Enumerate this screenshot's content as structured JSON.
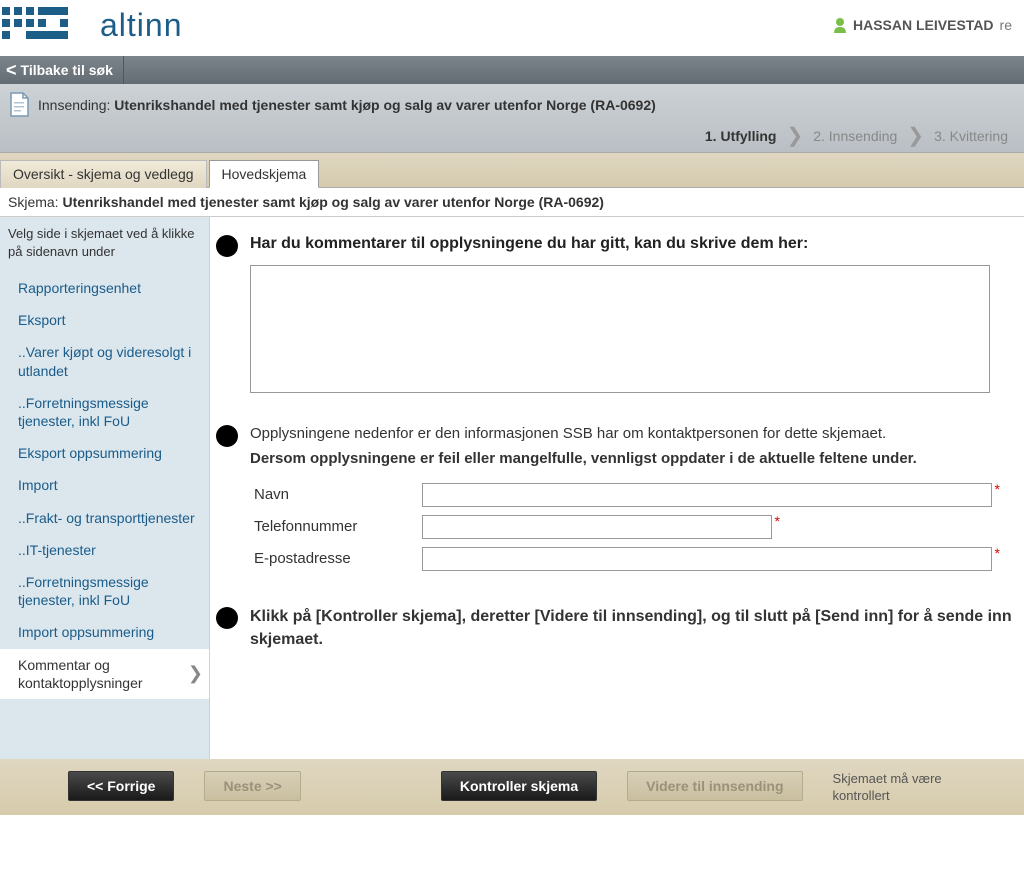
{
  "header": {
    "brand": "altinn",
    "user_name": "HASSAN LEIVESTAD",
    "user_suffix": "re"
  },
  "back": {
    "label": "Tilbake til søk",
    "caret": "<"
  },
  "submission": {
    "prefix": "Innsending: ",
    "title": "Utenrikshandel med tjenester samt kjøp og salg av varer utenfor Norge (RA-0692)"
  },
  "steps": {
    "s1": "1. Utfylling",
    "s2": "2. Innsending",
    "s3": "3. Kvittering",
    "sep": "❯"
  },
  "tabs": {
    "overview": "Oversikt - skjema og vedlegg",
    "main": "Hovedskjema"
  },
  "schema": {
    "prefix": "Skjema: ",
    "title": "Utenrikshandel med tjenester samt kjøp og salg av varer utenfor Norge (RA-0692)"
  },
  "sidebar": {
    "instructions": "Velg side i skjemaet ved å klikke på sidenavn under",
    "items": [
      "Rapporteringsenhet",
      "Eksport",
      "..Varer kjøpt og videresolgt i utlandet",
      "..Forretningsmessige tjenester, inkl FoU",
      "Eksport oppsummering",
      "Import",
      "..Frakt- og transporttjenester",
      "..IT-tjenester",
      "..Forretningsmessige tjenester, inkl FoU",
      "Import oppsummering",
      "Kommentar og kontaktopplysninger"
    ]
  },
  "main": {
    "q1": "Har du kommentarer til opplysningene du har gitt, kan du skrive dem her:",
    "info1": "Opplysningene nedenfor er den informasjonen SSB har om kontaktpersonen for dette skjemaet.",
    "info2": "Dersom opplysningene er feil eller mangelfulle, vennligst oppdater i de aktuelle feltene under.",
    "fields": {
      "name_label": "Navn",
      "phone_label": "Telefonnummer",
      "email_label": "E-postadresse",
      "star": "*"
    },
    "instr": "Klikk på [Kontroller skjema], deretter [Videre til innsending], og til slutt på [Send inn] for å sende inn skjemaet."
  },
  "footer": {
    "prev": "<< Forrige",
    "next": "Neste >>",
    "check": "Kontroller skjema",
    "forward": "Videre til innsending",
    "note": "Skjemaet må være kontrollert"
  }
}
